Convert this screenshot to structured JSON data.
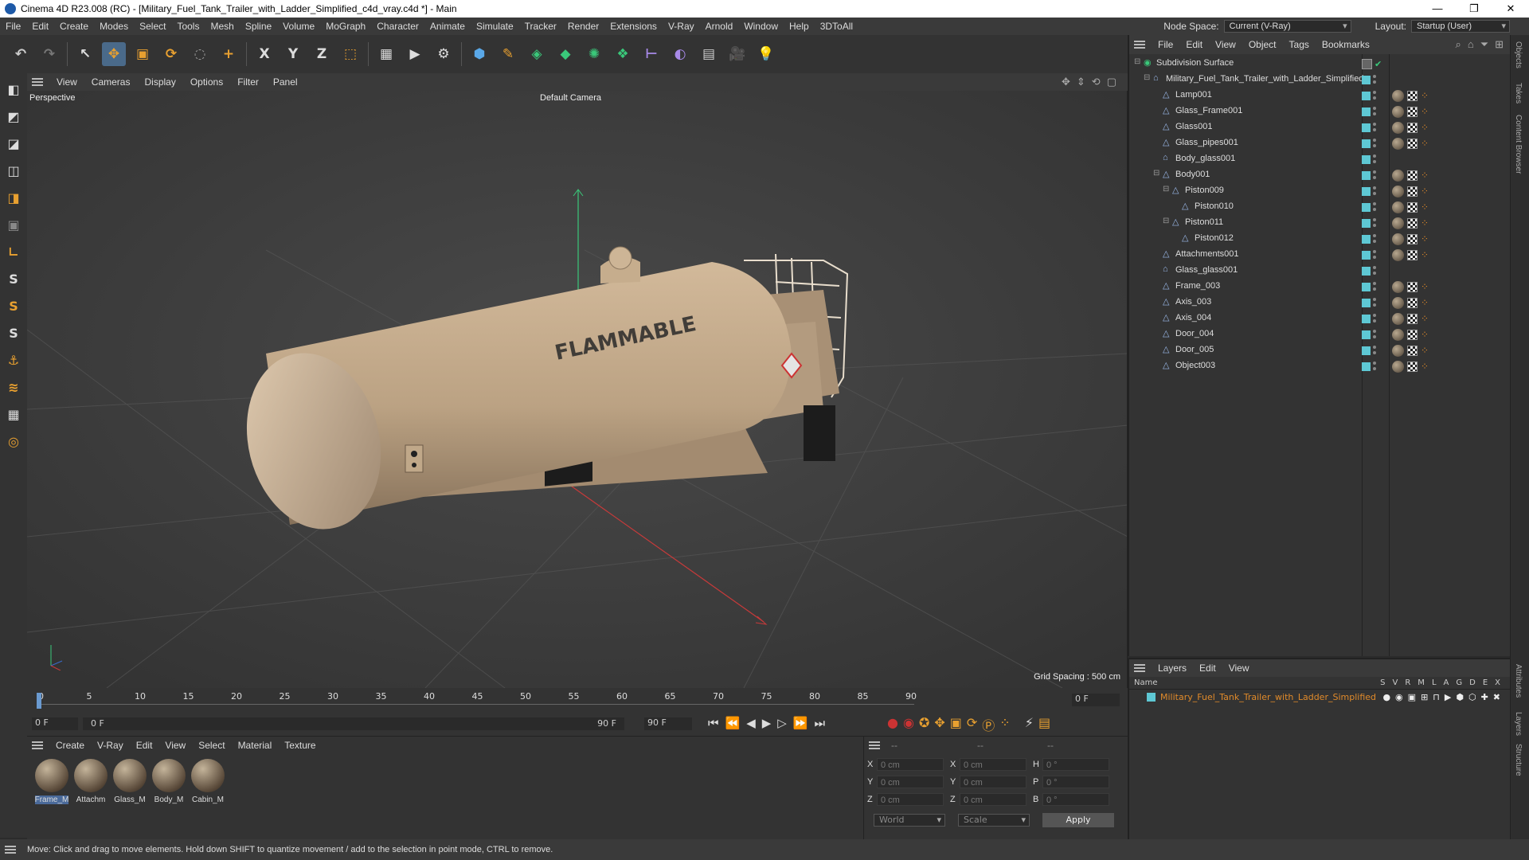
{
  "window": {
    "title": "Cinema 4D R23.008 (RC) - [Military_Fuel_Tank_Trailer_with_Ladder_Simplified_c4d_vray.c4d *] - Main",
    "min": "—",
    "max": "❐",
    "close": "✕"
  },
  "menu": {
    "items": [
      "File",
      "Edit",
      "Create",
      "Modes",
      "Select",
      "Tools",
      "Mesh",
      "Spline",
      "Volume",
      "MoGraph",
      "Character",
      "Animate",
      "Simulate",
      "Tracker",
      "Render",
      "Extensions",
      "V-Ray",
      "Arnold",
      "Window",
      "Help",
      "3DToAll"
    ],
    "node_space_label": "Node Space:",
    "node_space_value": "Current (V-Ray)",
    "layout_label": "Layout:",
    "layout_value": "Startup (User)"
  },
  "toolbar": {
    "icons": [
      "undo-icon",
      "redo-icon",
      "select-icon",
      "move-icon",
      "scale-icon",
      "rotate-icon",
      "live-select-icon",
      "add-icon",
      "x-axis-icon",
      "y-axis-icon",
      "z-axis-icon",
      "coord-system-icon",
      "render-region-icon",
      "render-view-icon",
      "render-settings-icon",
      "cube-icon",
      "pen-icon",
      "subdivision-icon",
      "extrude-icon",
      "array-icon",
      "cloner-icon",
      "symmetry-icon",
      "deformer-icon",
      "floor-icon",
      "camera-icon",
      "light-icon"
    ],
    "glyphs": [
      "↶",
      "↷",
      "↖",
      "✥",
      "▣",
      "⟳",
      "◌",
      "+",
      "X",
      "Y",
      "Z",
      "⬚",
      "▦",
      "▶",
      "⚙",
      "⬢",
      "✎",
      "◈",
      "◆",
      "✺",
      "❖",
      "⊢",
      "◐",
      "▤",
      "🎥",
      "💡"
    ]
  },
  "lefttools": {
    "glyphs": [
      "◧",
      "◩",
      "◪",
      "◫",
      "◨",
      "▣",
      "∟",
      "S",
      "S",
      "S",
      "⚓",
      "≋",
      "▦",
      "◎"
    ]
  },
  "viewport": {
    "menu": [
      "View",
      "Cameras",
      "Display",
      "Options",
      "Filter",
      "Panel"
    ],
    "label": "Perspective",
    "camera": "Default Camera",
    "grid_spacing": "Grid Spacing : 500 cm",
    "stencil": "FLAMMABLE"
  },
  "timeline": {
    "ticks": [
      "0",
      "5",
      "10",
      "15",
      "20",
      "25",
      "30",
      "35",
      "40",
      "45",
      "50",
      "55",
      "60",
      "65",
      "70",
      "75",
      "80",
      "85",
      "90"
    ],
    "current_frame": "0 F"
  },
  "playbar": {
    "start": "0 F",
    "range_start": "0 F",
    "range_end": "90 F",
    "end": "90 F",
    "glyphs": [
      "⏮",
      "⏪",
      "◀",
      "▶",
      "▷",
      "⏩",
      "⏭"
    ]
  },
  "materials": {
    "menu": [
      "Create",
      "V-Ray",
      "Edit",
      "View",
      "Select",
      "Material",
      "Texture"
    ],
    "items": [
      "Frame_M",
      "Attachm",
      "Glass_M",
      "Body_M",
      "Cabin_M"
    ]
  },
  "coords": {
    "header": [
      "--",
      "--",
      "--"
    ],
    "rows": [
      {
        "a": "X",
        "av": "0 cm",
        "b": "X",
        "bv": "0 cm",
        "c": "H",
        "cv": "0 °"
      },
      {
        "a": "Y",
        "av": "0 cm",
        "b": "Y",
        "bv": "0 cm",
        "c": "P",
        "cv": "0 °"
      },
      {
        "a": "Z",
        "av": "0 cm",
        "b": "Z",
        "bv": "0 cm",
        "c": "B",
        "cv": "0 °"
      }
    ],
    "world": "World",
    "scale": "Scale",
    "apply": "Apply"
  },
  "objects": {
    "menu": [
      "File",
      "Edit",
      "View",
      "Object",
      "Tags",
      "Bookmarks"
    ],
    "rows": [
      {
        "name": "Subdivision Surface",
        "level": 0,
        "icon": "◉",
        "tags": 0
      },
      {
        "name": "Military_Fuel_Tank_Trailer_with_Ladder_Simplified",
        "level": 1,
        "icon": "⌂",
        "tags": 0
      },
      {
        "name": "Lamp001",
        "level": 2,
        "icon": "△",
        "tags": 1
      },
      {
        "name": "Glass_Frame001",
        "level": 2,
        "icon": "△",
        "tags": 1
      },
      {
        "name": "Glass001",
        "level": 2,
        "icon": "△",
        "tags": 1
      },
      {
        "name": "Glass_pipes001",
        "level": 2,
        "icon": "△",
        "tags": 1
      },
      {
        "name": "Body_glass001",
        "level": 2,
        "icon": "⌂",
        "tags": 0
      },
      {
        "name": "Body001",
        "level": 2,
        "icon": "△",
        "tags": 1
      },
      {
        "name": "Piston009",
        "level": 3,
        "icon": "△",
        "tags": 1
      },
      {
        "name": "Piston010",
        "level": 4,
        "icon": "△",
        "tags": 1
      },
      {
        "name": "Piston011",
        "level": 3,
        "icon": "△",
        "tags": 1
      },
      {
        "name": "Piston012",
        "level": 4,
        "icon": "△",
        "tags": 1
      },
      {
        "name": "Attachments001",
        "level": 2,
        "icon": "△",
        "tags": 1
      },
      {
        "name": "Glass_glass001",
        "level": 2,
        "icon": "⌂",
        "tags": 0
      },
      {
        "name": "Frame_003",
        "level": 2,
        "icon": "△",
        "tags": 1
      },
      {
        "name": "Axis_003",
        "level": 2,
        "icon": "△",
        "tags": 1
      },
      {
        "name": "Axis_004",
        "level": 2,
        "icon": "△",
        "tags": 1
      },
      {
        "name": "Door_004",
        "level": 2,
        "icon": "△",
        "tags": 1
      },
      {
        "name": "Door_005",
        "level": 2,
        "icon": "△",
        "tags": 1
      },
      {
        "name": "Object003",
        "level": 2,
        "icon": "△",
        "tags": 1
      }
    ]
  },
  "layers": {
    "menu": [
      "Layers",
      "Edit",
      "View"
    ],
    "col_name": "Name",
    "cols": [
      "S",
      "V",
      "R",
      "M",
      "L",
      "A",
      "G",
      "D",
      "E",
      "X"
    ],
    "row": "Military_Fuel_Tank_Trailer_with_Ladder_Simplified"
  },
  "rightstrip": {
    "tabs": [
      "Objects",
      "Takes",
      "Content Browser",
      "Attributes",
      "Layers",
      "Structure"
    ]
  },
  "status": {
    "text": "Move: Click and drag to move elements. Hold down SHIFT to quantize movement / add to the selection in point mode, CTRL to remove."
  },
  "colors": {
    "accent": "#5ec8d4",
    "tag_orange": "#e08a2a",
    "layer_orange": "#e08a2a"
  }
}
